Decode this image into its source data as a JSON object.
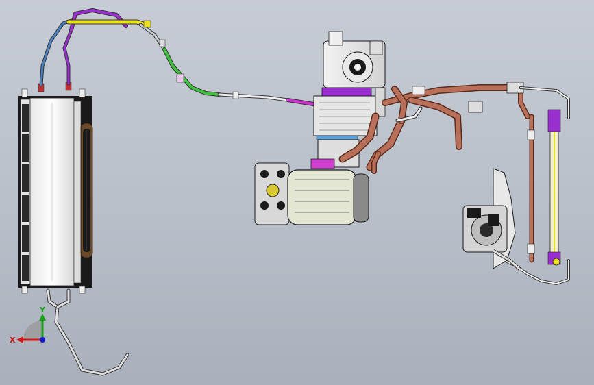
{
  "viewport": {
    "background_top": "#c7ccd4",
    "background_bottom": "#a9b0bb"
  },
  "triad": {
    "x_label": "X",
    "y_label": "Y",
    "x_color": "#d01818",
    "y_color": "#18a018",
    "z_color": "#1818d0"
  },
  "pipe_colors": {
    "blue_line": "#4a7fc0",
    "purple_line": "#9a2fd0",
    "yellow_line": "#e8e020",
    "green_line": "#40c040",
    "magenta_line": "#d030d0",
    "copper_hose": "#b8705a",
    "gray_line": "#c8ccd2"
  }
}
